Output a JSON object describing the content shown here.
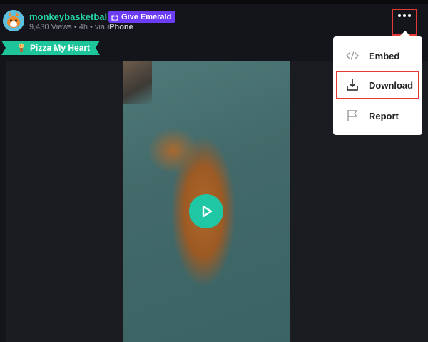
{
  "post": {
    "username": "monkeybasketball",
    "give_emerald_label": "Give Emerald",
    "views": "9,430 Views",
    "separator": "•",
    "age": "4h",
    "via_prefix": "via",
    "via_device": "iPhone",
    "badge_label": "Pizza My Heart"
  },
  "menu": {
    "items": [
      {
        "label": "Embed",
        "icon": "embed-icon"
      },
      {
        "label": "Download",
        "icon": "download-icon"
      },
      {
        "label": "Report",
        "icon": "flag-icon"
      }
    ]
  },
  "colors": {
    "accent_green": "#24d6a8",
    "emerald_purple": "#6c3df5",
    "play_button": "#1fc7a5",
    "highlight_red": "#e53935",
    "background": "#14151a"
  }
}
